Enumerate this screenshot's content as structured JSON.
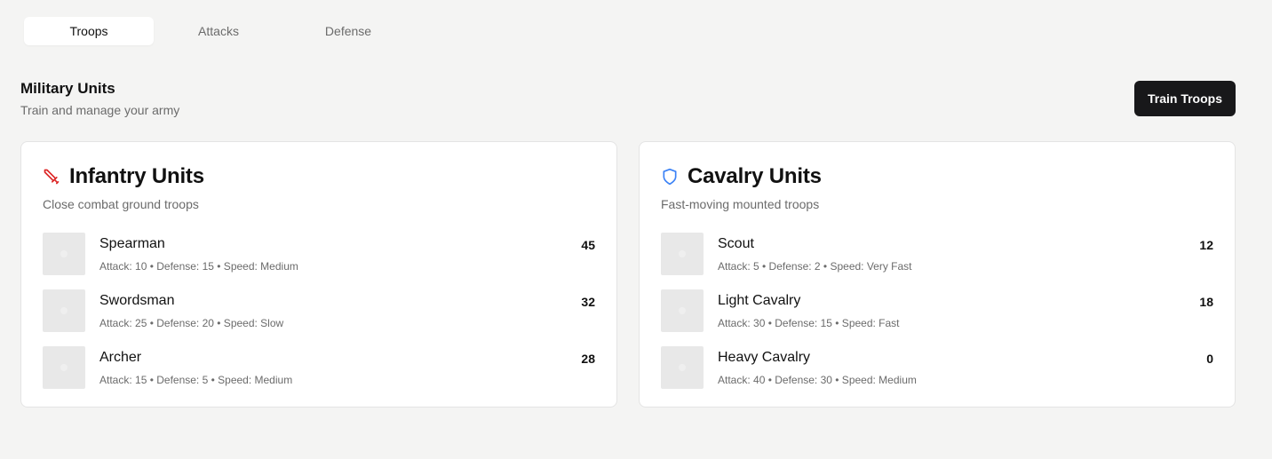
{
  "tabs": [
    {
      "label": "Troops",
      "active": true
    },
    {
      "label": "Attacks",
      "active": false
    },
    {
      "label": "Defense",
      "active": false
    }
  ],
  "header": {
    "title": "Military Units",
    "subtitle": "Train and manage your army",
    "train_button": "Train Troops"
  },
  "cards": [
    {
      "icon": "sword-icon",
      "icon_color": "#dc2626",
      "title": "Infantry Units",
      "description": "Close combat ground troops",
      "units": [
        {
          "name": "Spearman",
          "stats": "Attack: 10 • Defense: 15 • Speed: Medium",
          "count": "45"
        },
        {
          "name": "Swordsman",
          "stats": "Attack: 25 • Defense: 20 • Speed: Slow",
          "count": "32"
        },
        {
          "name": "Archer",
          "stats": "Attack: 15 • Defense: 5 • Speed: Medium",
          "count": "28"
        }
      ]
    },
    {
      "icon": "shield-icon",
      "icon_color": "#3b82f6",
      "title": "Cavalry Units",
      "description": "Fast-moving mounted troops",
      "units": [
        {
          "name": "Scout",
          "stats": "Attack: 5 • Defense: 2 • Speed: Very Fast",
          "count": "12"
        },
        {
          "name": "Light Cavalry",
          "stats": "Attack: 30 • Defense: 15 • Speed: Fast",
          "count": "18"
        },
        {
          "name": "Heavy Cavalry",
          "stats": "Attack: 40 • Defense: 30 • Speed: Medium",
          "count": "0"
        }
      ]
    }
  ]
}
